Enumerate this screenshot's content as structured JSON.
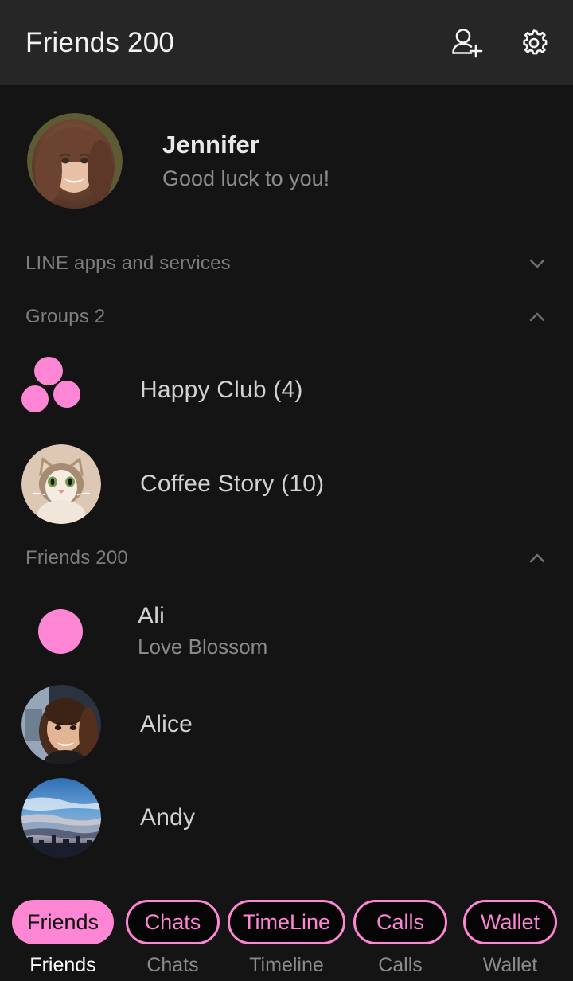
{
  "header": {
    "title": "Friends 200",
    "add_friend_icon": "add-person-icon",
    "settings_icon": "gear-icon"
  },
  "profile": {
    "name": "Jennifer",
    "status": "Good luck to you!",
    "avatar": "jennifer-photo"
  },
  "sections": {
    "apps": {
      "label": "LINE apps and services",
      "chevron": "chevron-down-icon",
      "expanded": false
    },
    "groups": {
      "label": "Groups 2",
      "chevron": "chevron-up-icon",
      "expanded": true
    },
    "friends": {
      "label": "Friends 200",
      "chevron": "chevron-up-icon",
      "expanded": true
    }
  },
  "groups": [
    {
      "name": "Happy Club (4)",
      "avatar": "group-dots-icon"
    },
    {
      "name": "Coffee Story (10)",
      "avatar": "cat-photo"
    }
  ],
  "friends": [
    {
      "name": "Ali",
      "status": "Love Blossom",
      "avatar": "pink-circle"
    },
    {
      "name": "Alice",
      "status": "",
      "avatar": "alice-photo"
    },
    {
      "name": "Andy",
      "status": "",
      "avatar": "sky-photo"
    }
  ],
  "bottom_nav": [
    {
      "pill": "Friends",
      "label": "Friends",
      "active": true
    },
    {
      "pill": "Chats",
      "label": "Chats",
      "active": false
    },
    {
      "pill": "TimeLine",
      "label": "Timeline",
      "active": false
    },
    {
      "pill": "Calls",
      "label": "Calls",
      "active": false
    },
    {
      "pill": "Wallet",
      "label": "Wallet",
      "active": false
    }
  ],
  "colors": {
    "accent_pink": "#FF85D5",
    "header_bg": "#262626",
    "body_bg": "#141414"
  }
}
